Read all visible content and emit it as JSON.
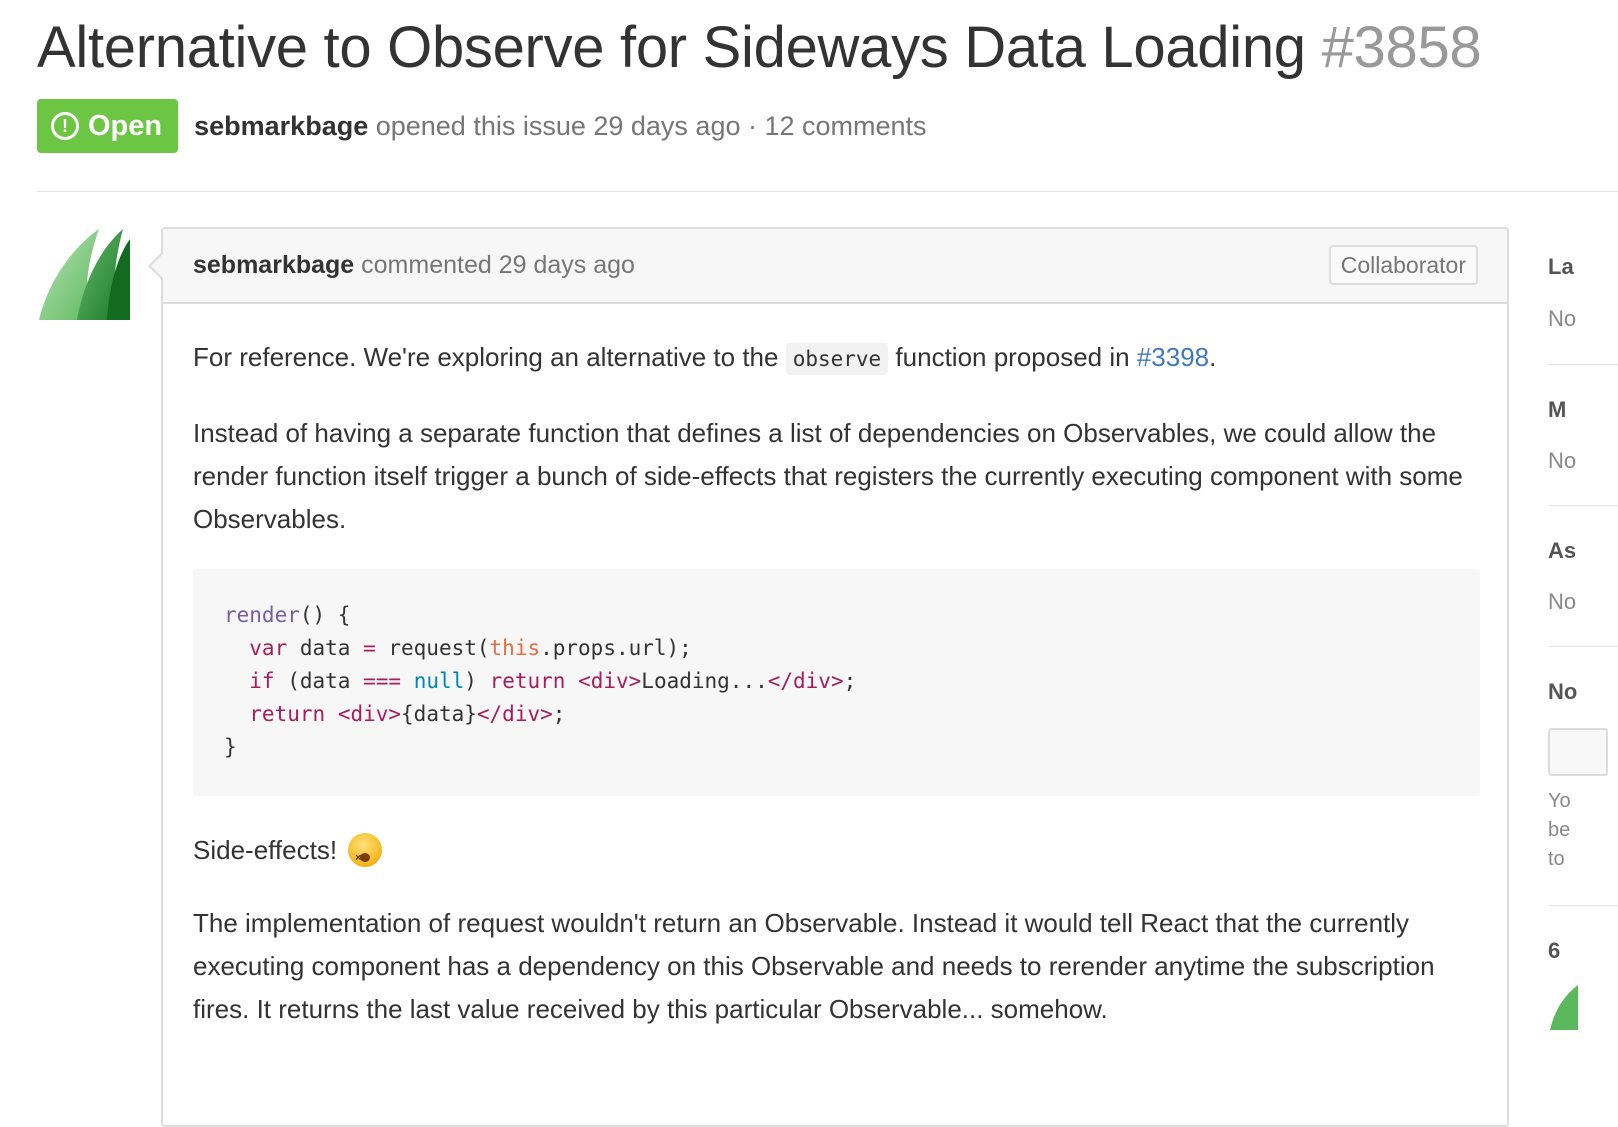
{
  "issue": {
    "title": "Alternative to Observe for Sideways Data Loading",
    "number": "#3858",
    "state_label": "Open",
    "state_icon": "issue-opened-icon",
    "author": "sebmarkbage",
    "opened_text": " opened this issue 29 days ago · 12 comments"
  },
  "colors": {
    "open_green": "#6cc644",
    "link_blue": "#4078c0",
    "keyword": "#a71d5d",
    "function": "#795da3",
    "this_kw": "#ed6a43",
    "constant": "#0086b3"
  },
  "comment": {
    "author": "sebmarkbage",
    "time_text": " commented 29 days ago",
    "badge": "Collaborator",
    "p1_before": "For reference. We're exploring an alternative to the ",
    "p1_code": "observe",
    "p1_middle": " function proposed in ",
    "p1_link": "#3398",
    "p1_end": ".",
    "p2": "Instead of having a separate function that defines a list of dependencies on Observables, we could allow the render function itself trigger a bunch of side-effects that registers the currently executing component with some Observables.",
    "code": {
      "l1_fn": "render",
      "l1_rest": "() {",
      "l2_kw": "  var",
      "l2_a": " data ",
      "l2_op": "=",
      "l2_b": " request(",
      "l2_this": "this",
      "l2_c": ".props.url);",
      "l3_kw": "  if",
      "l3_a": " (data ",
      "l3_op": "===",
      "l3_sp": " ",
      "l3_null": "null",
      "l3_b": ") ",
      "l3_ret": "return",
      "l3_sp2": " ",
      "l3_t1": "<div>",
      "l3_txt": "Loading...",
      "l3_t2": "</div>",
      "l3_end": ";",
      "l4_kw": "  return",
      "l4_sp": " ",
      "l4_t1": "<div>",
      "l4_txt": "{data}",
      "l4_t2": "</div>",
      "l4_end": ";",
      "l5": "}"
    },
    "p3": "Side-effects!",
    "p3_emoji": "dizzy-face-emoji",
    "p4": "The implementation of request wouldn't return an Observable. Instead it would tell React that the currently executing component has a dependency on this Observable and needs to rerender anytime the subscription fires. It returns the last value received by this particular Observable... somehow."
  },
  "sidebar": {
    "labels_title": "La",
    "labels_value": "No",
    "milestone_title": "M",
    "milestone_value": "No",
    "assignee_title": "As",
    "assignee_value": "No",
    "notifications_title": "No",
    "notif_line1": "Yo",
    "notif_line2": "be",
    "notif_line3": "to",
    "participants_title": "6"
  }
}
